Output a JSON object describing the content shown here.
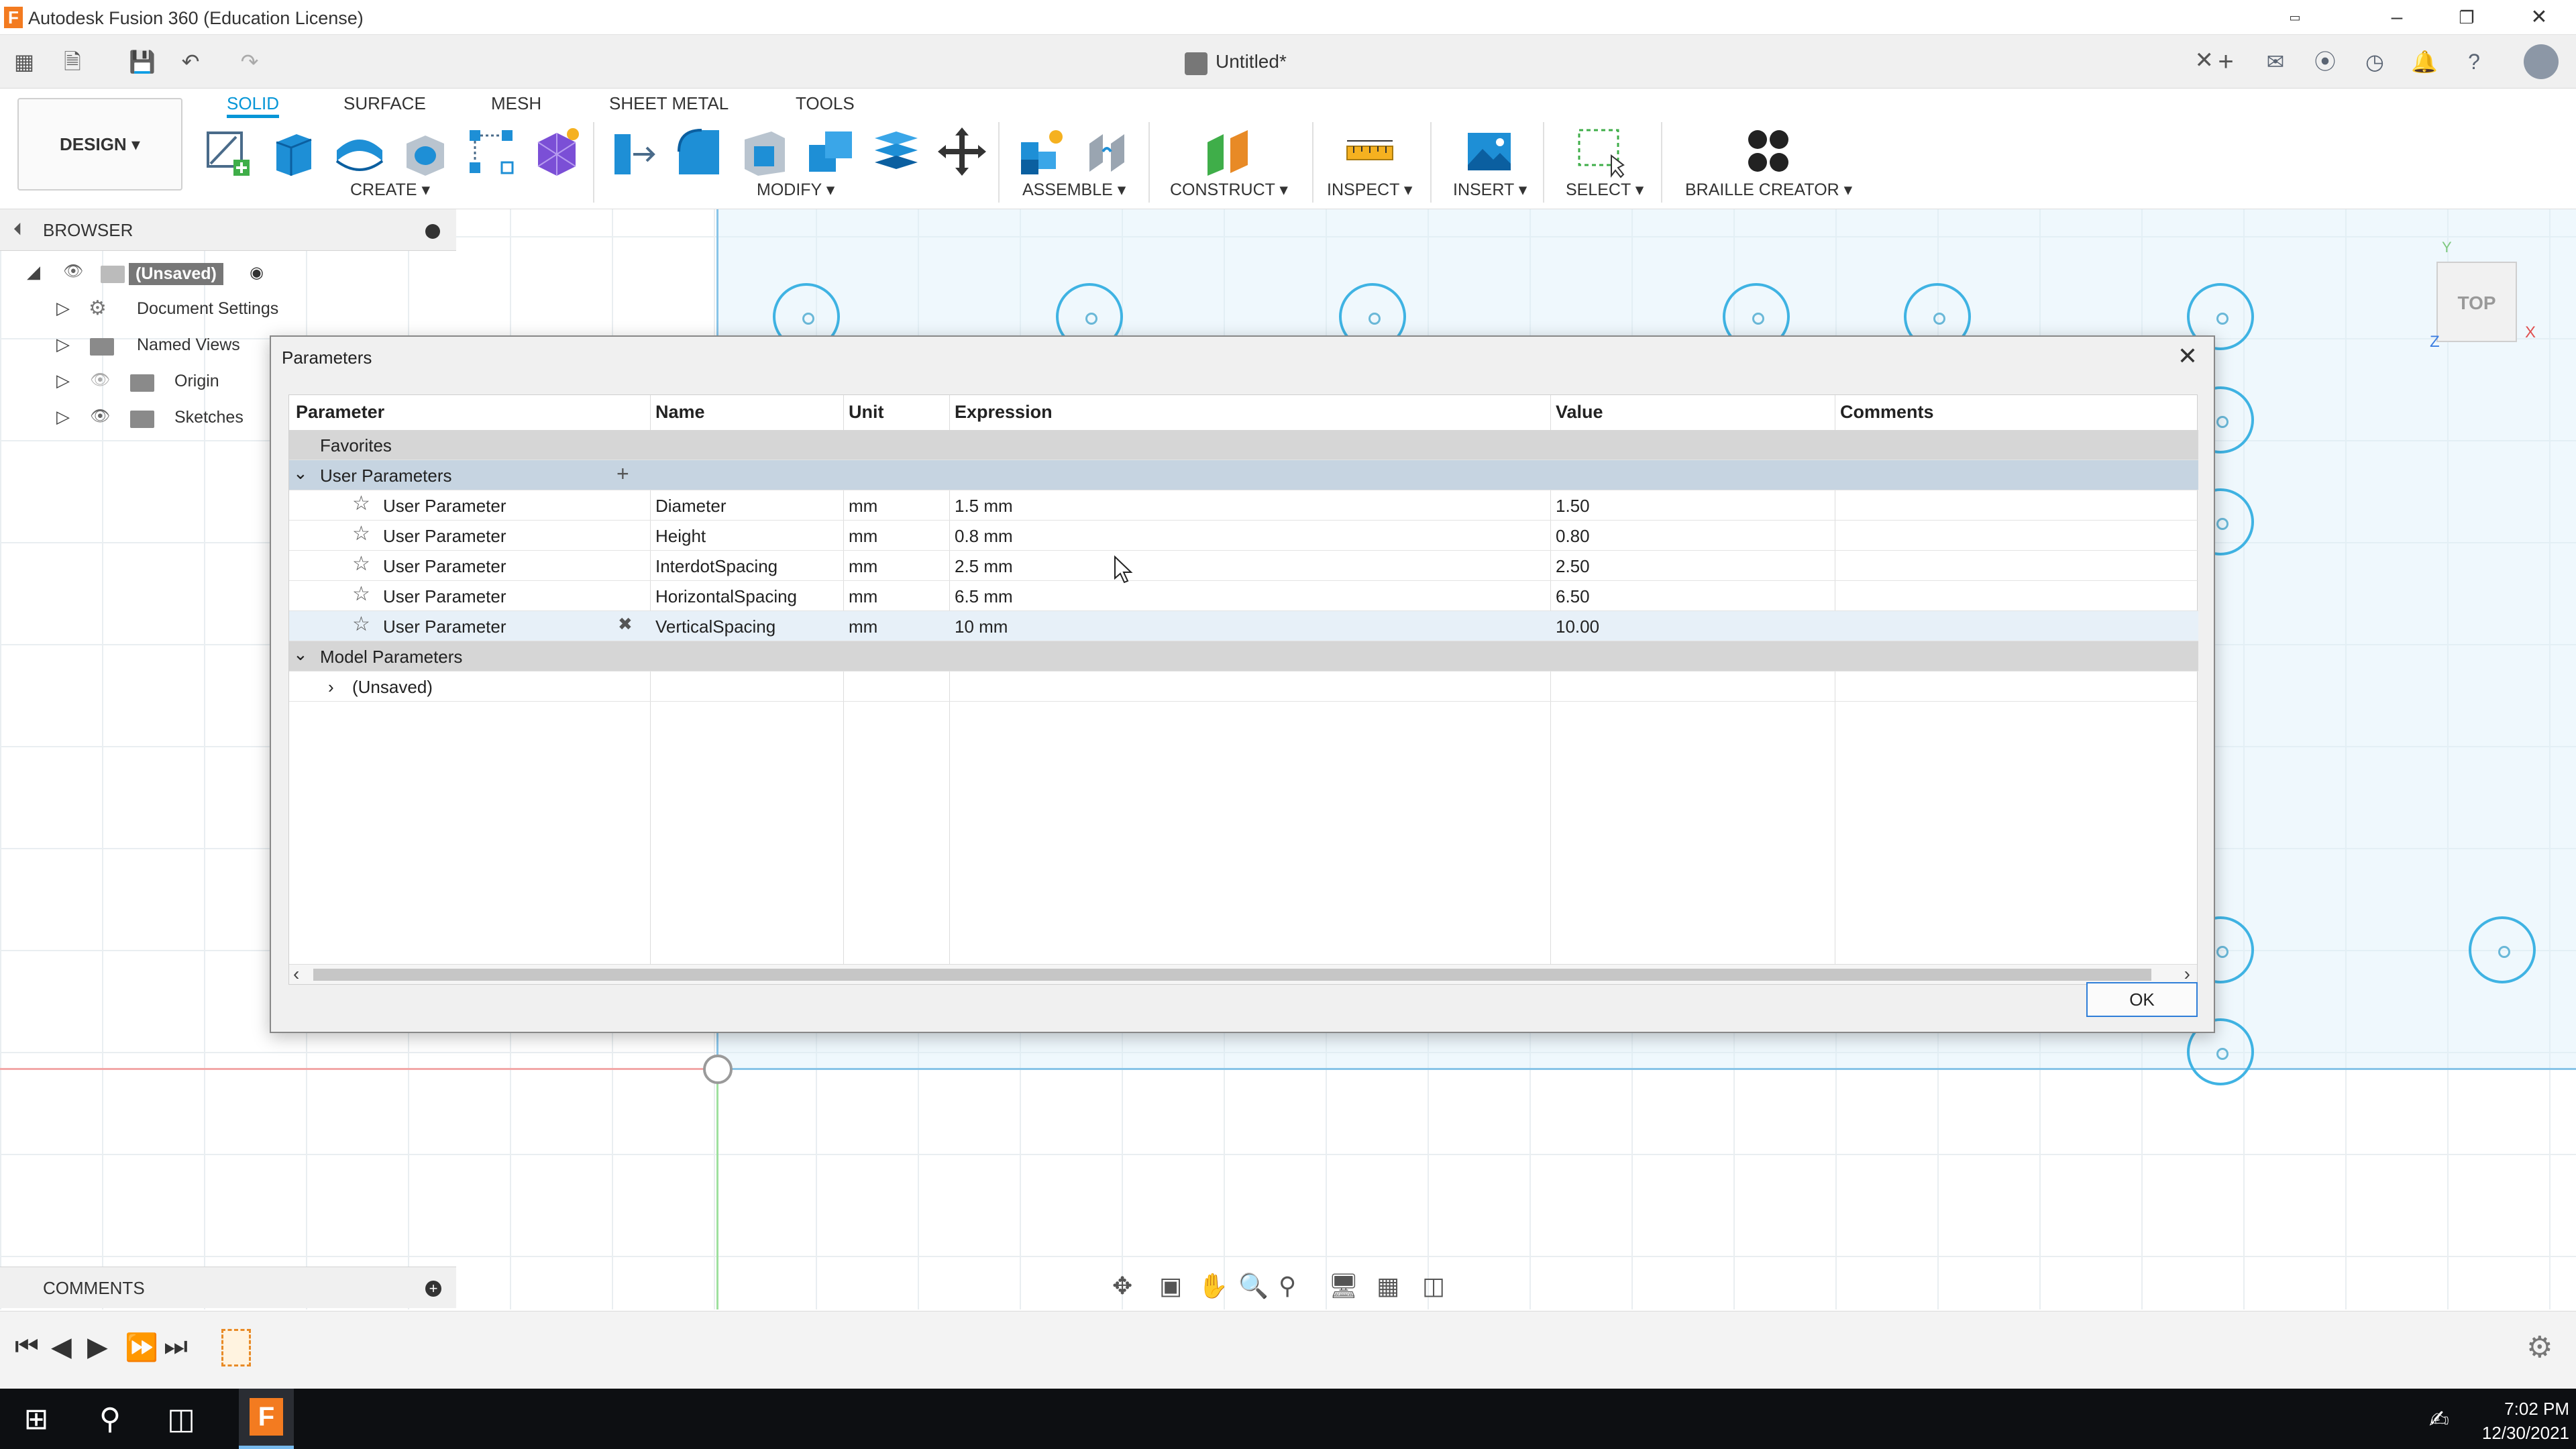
{
  "window": {
    "title": "Autodesk Fusion 360 (Education License)",
    "logo_letter": "F"
  },
  "document": {
    "title": "Untitled*"
  },
  "workspace": {
    "label": "DESIGN ▾"
  },
  "tabs": [
    "SOLID",
    "SURFACE",
    "MESH",
    "SHEET METAL",
    "TOOLS"
  ],
  "toolbar_groups": {
    "create": "CREATE ▾",
    "modify": "MODIFY ▾",
    "assemble": "ASSEMBLE ▾",
    "construct": "CONSTRUCT ▾",
    "inspect": "INSPECT ▾",
    "insert": "INSERT ▾",
    "select": "SELECT ▾",
    "braille": "BRAILLE CREATOR ▾"
  },
  "browser": {
    "title": "BROWSER",
    "root": "(Unsaved)",
    "items": [
      "Document Settings",
      "Named Views",
      "Origin",
      "Sketches"
    ]
  },
  "comments": {
    "title": "COMMENTS"
  },
  "viewcube": {
    "face": "TOP",
    "axis_y": "Y",
    "axis_z": "Z",
    "axis_x": "X"
  },
  "dialog": {
    "title": "Parameters",
    "columns": [
      "Parameter",
      "Name",
      "Unit",
      "Expression",
      "Value",
      "Comments"
    ],
    "favorites_label": "Favorites",
    "user_group_label": "User Parameters",
    "model_group_label": "Model Parameters",
    "model_child": "(Unsaved)",
    "user_parameters": [
      {
        "type": "User Parameter",
        "name": "Diameter",
        "unit": "mm",
        "expression": "1.5 mm",
        "value": "1.50",
        "comments": ""
      },
      {
        "type": "User Parameter",
        "name": "Height",
        "unit": "mm",
        "expression": "0.8 mm",
        "value": "0.80",
        "comments": ""
      },
      {
        "type": "User Parameter",
        "name": "InterdotSpacing",
        "unit": "mm",
        "expression": "2.5 mm",
        "value": "2.50",
        "comments": ""
      },
      {
        "type": "User Parameter",
        "name": "HorizontalSpacing",
        "unit": "mm",
        "expression": "6.5 mm",
        "value": "6.50",
        "comments": ""
      },
      {
        "type": "User Parameter",
        "name": "VerticalSpacing",
        "unit": "mm",
        "expression": "10 mm",
        "value": "10.00",
        "comments": ""
      }
    ],
    "ok_label": "OK"
  },
  "taskbar": {
    "time": "7:02 PM",
    "date": "12/30/2021"
  },
  "colors": {
    "accent": "#0696d7",
    "sketch_circle": "#3fb3e3",
    "taskbar": "#0d0f12"
  }
}
